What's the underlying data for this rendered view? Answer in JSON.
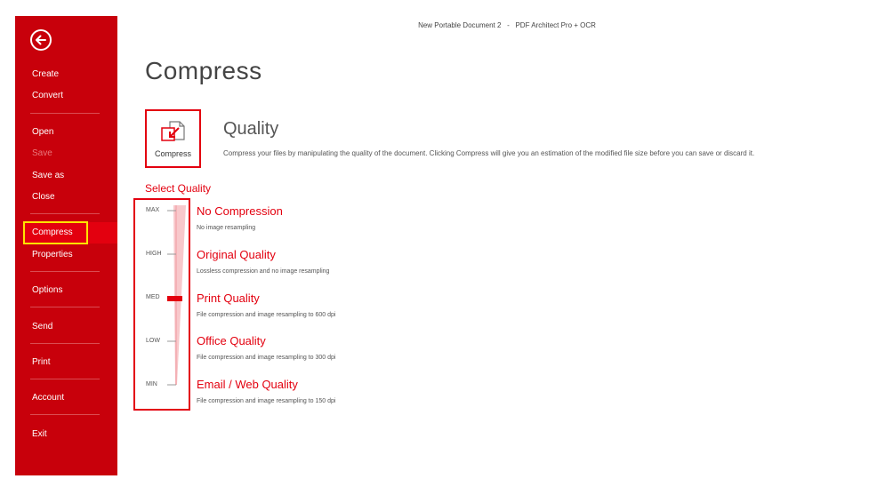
{
  "window": {
    "document_name": "New Portable Document 2",
    "separator": "-",
    "app_name": "PDF Architect Pro + OCR"
  },
  "sidebar": {
    "back_icon": "back-arrow-icon",
    "items": [
      {
        "label": "Create",
        "state": "normal"
      },
      {
        "label": "Convert",
        "state": "normal"
      },
      {
        "label": "Open",
        "state": "normal"
      },
      {
        "label": "Save",
        "state": "disabled"
      },
      {
        "label": "Save as",
        "state": "normal"
      },
      {
        "label": "Close",
        "state": "normal"
      },
      {
        "label": "Compress",
        "state": "selected"
      },
      {
        "label": "Properties",
        "state": "normal"
      },
      {
        "label": "Options",
        "state": "normal"
      },
      {
        "label": "Send",
        "state": "normal"
      },
      {
        "label": "Print",
        "state": "normal"
      },
      {
        "label": "Account",
        "state": "normal"
      },
      {
        "label": "Exit",
        "state": "normal"
      }
    ]
  },
  "main": {
    "title": "Compress",
    "compress_tile": {
      "label": "Compress",
      "icon": "compress-icon"
    },
    "quality": {
      "heading": "Quality",
      "description": "Compress your files by manipulating the quality of the document. Clicking Compress will give you an estimation of the modified file size before you can save or discard it."
    },
    "select_quality": {
      "label": "Select Quality",
      "ticks": [
        "MAX",
        "HIGH",
        "MED",
        "LOW",
        "MIN"
      ],
      "selected_index": 2,
      "options": [
        {
          "title": "No Compression",
          "description": "No image resampling"
        },
        {
          "title": "Original Quality",
          "description": "Lossless compression and no image resampling"
        },
        {
          "title": "Print Quality",
          "description": "File compression and image resampling to 600 dpi"
        },
        {
          "title": "Office Quality",
          "description": "File compression and image resampling to 300 dpi"
        },
        {
          "title": "Email / Web Quality",
          "description": "File compression and image resampling to 150 dpi"
        }
      ]
    }
  },
  "colors": {
    "sidebar_bg": "#c8000b",
    "accent": "#e3000f",
    "highlight": "#ffe400"
  }
}
